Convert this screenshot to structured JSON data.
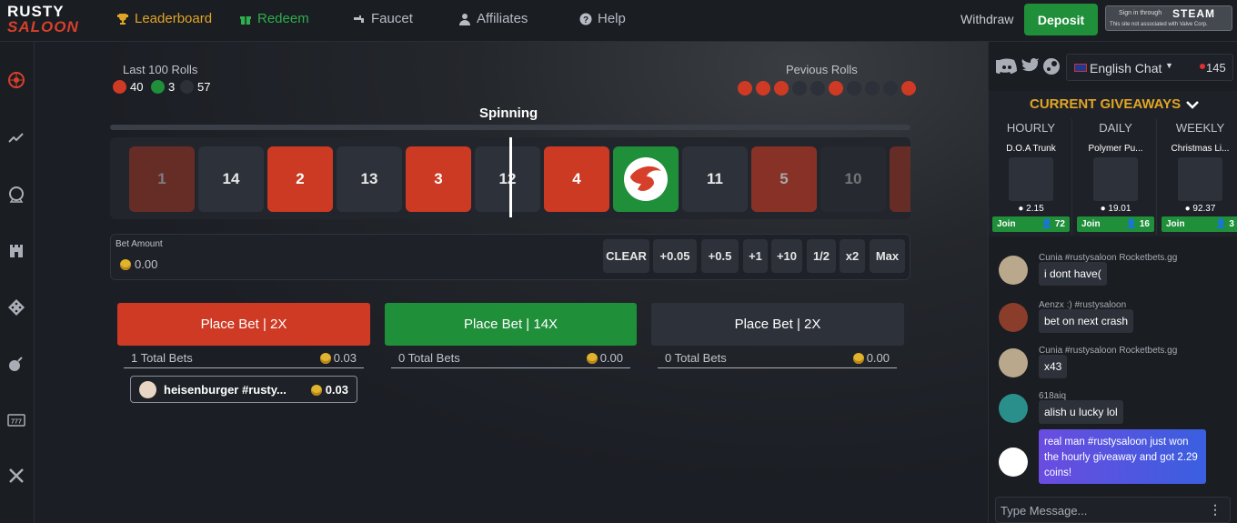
{
  "header": {
    "logo_top": "RUSTY",
    "logo_bottom": "SALOON",
    "nav": [
      {
        "label": "Leaderboard",
        "icon": "trophy-icon",
        "color": "#e0a526"
      },
      {
        "label": "Redeem",
        "icon": "gift-icon",
        "color": "#2fae4d"
      },
      {
        "label": "Faucet",
        "icon": "faucet-icon",
        "color": "#b7bcc4"
      },
      {
        "label": "Affiliates",
        "icon": "user-icon",
        "color": "#b7bcc4"
      },
      {
        "label": "Help",
        "icon": "question-icon",
        "color": "#b7bcc4"
      }
    ],
    "withdraw": "Withdraw",
    "deposit": "Deposit",
    "steam_top": "Sign in through",
    "steam_brand": "STEAM",
    "steam_note": "This site not associated with Valve Corp."
  },
  "sidebar": {
    "icons": [
      "roulette-icon",
      "crash-graph-icon",
      "coinflip-icon",
      "castle-icon",
      "dice-icon",
      "bomb-icon",
      "slots-icon",
      "swords-icon"
    ]
  },
  "game": {
    "last_rolls_label": "Last 100 Rolls",
    "stats": {
      "red": "40",
      "green": "3",
      "dark": "57"
    },
    "previous_label": "Pevious Rolls",
    "previous": [
      "red",
      "red",
      "red",
      "dark",
      "dark",
      "red",
      "dark",
      "dark",
      "dark",
      "red"
    ],
    "status": "Spinning",
    "tiles": [
      {
        "label": "1",
        "color": "red"
      },
      {
        "label": "14",
        "color": "dark"
      },
      {
        "label": "2",
        "color": "red"
      },
      {
        "label": "13",
        "color": "dark"
      },
      {
        "label": "3",
        "color": "red"
      },
      {
        "label": "12",
        "color": "dark"
      },
      {
        "label": "4",
        "color": "red"
      },
      {
        "label": "",
        "color": "green"
      },
      {
        "label": "11",
        "color": "dark"
      },
      {
        "label": "5",
        "color": "red"
      },
      {
        "label": "10",
        "color": "dark"
      },
      {
        "label": "",
        "color": "red"
      }
    ],
    "bet_amount_label": "Bet Amount",
    "bet_amount": "0.00",
    "bet_buttons": [
      "CLEAR",
      "+0.05",
      "+0.5",
      "+1",
      "+10",
      "1/2",
      "x2",
      "Max"
    ]
  },
  "columns": [
    {
      "button": "Place Bet | 2X",
      "color": "#cf3a24",
      "total": "1 Total Bets",
      "amount": "0.03"
    },
    {
      "button": "Place Bet | 14X",
      "color": "#1f8f3a",
      "total": "0 Total Bets",
      "amount": "0.00"
    },
    {
      "button": "Place Bet | 2X",
      "color": "#2d3139",
      "total": "0 Total Bets",
      "amount": "0.00"
    }
  ],
  "user_bet": {
    "name": "heisenburger #rusty...",
    "amount": "0.03"
  },
  "chat": {
    "icons": [
      "discord-icon",
      "twitter-icon",
      "steam-icon"
    ],
    "language": "English Chat",
    "online": "145",
    "giveaways_title": "CURRENT GIVEAWAYS",
    "giveaways": [
      {
        "period": "HOURLY",
        "item": "D.O.A Trunk",
        "value": "2.15",
        "join": "Join",
        "entrants": "72"
      },
      {
        "period": "DAILY",
        "item": "Polymer Pu...",
        "value": "19.01",
        "join": "Join",
        "entrants": "16"
      },
      {
        "period": "WEEKLY",
        "item": "Christmas Li...",
        "value": "92.37",
        "join": "Join",
        "entrants": "3"
      }
    ],
    "messages": [
      {
        "user": "Cunia #rustysaloon Rocketbets.gg",
        "text": "i dont have("
      },
      {
        "user": "Aenzx :) #rustysaloon",
        "text": "bet on next crash"
      },
      {
        "user": "Cunia #rustysaloon Rocketbets.gg",
        "text": "x43"
      },
      {
        "user": "618aiq",
        "text": "alish u lucky lol"
      },
      {
        "user": "",
        "text": "real man #rustysaloon just won the hourly giveaway and got 2.29 coins!"
      }
    ],
    "input_placeholder": "Type Message..."
  }
}
